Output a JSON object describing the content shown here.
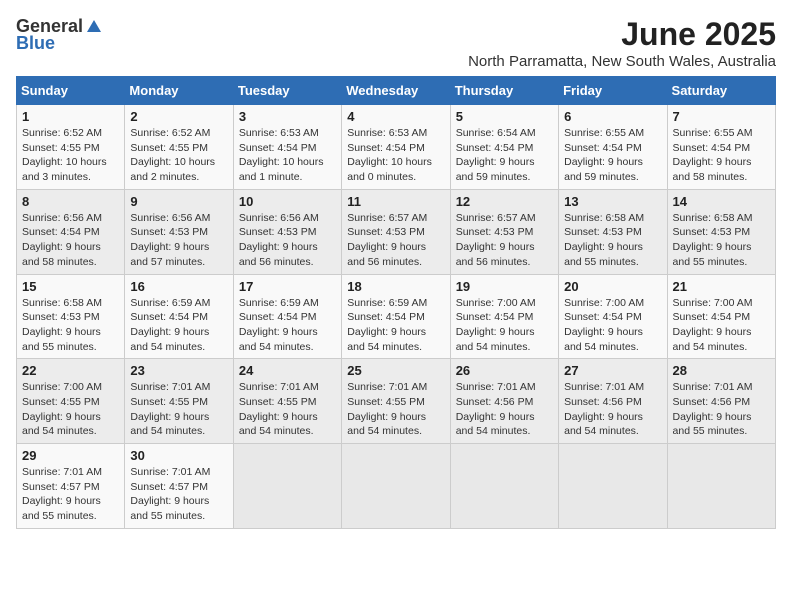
{
  "logo": {
    "general": "General",
    "blue": "Blue"
  },
  "title": "June 2025",
  "location": "North Parramatta, New South Wales, Australia",
  "weekdays": [
    "Sunday",
    "Monday",
    "Tuesday",
    "Wednesday",
    "Thursday",
    "Friday",
    "Saturday"
  ],
  "weeks": [
    [
      {
        "day": "1",
        "rise": "6:52 AM",
        "set": "4:55 PM",
        "daylight": "10 hours and 3 minutes."
      },
      {
        "day": "2",
        "rise": "6:52 AM",
        "set": "4:55 PM",
        "daylight": "10 hours and 2 minutes."
      },
      {
        "day": "3",
        "rise": "6:53 AM",
        "set": "4:54 PM",
        "daylight": "10 hours and 1 minute."
      },
      {
        "day": "4",
        "rise": "6:53 AM",
        "set": "4:54 PM",
        "daylight": "10 hours and 0 minutes."
      },
      {
        "day": "5",
        "rise": "6:54 AM",
        "set": "4:54 PM",
        "daylight": "9 hours and 59 minutes."
      },
      {
        "day": "6",
        "rise": "6:55 AM",
        "set": "4:54 PM",
        "daylight": "9 hours and 59 minutes."
      },
      {
        "day": "7",
        "rise": "6:55 AM",
        "set": "4:54 PM",
        "daylight": "9 hours and 58 minutes."
      }
    ],
    [
      {
        "day": "8",
        "rise": "6:56 AM",
        "set": "4:54 PM",
        "daylight": "9 hours and 58 minutes."
      },
      {
        "day": "9",
        "rise": "6:56 AM",
        "set": "4:53 PM",
        "daylight": "9 hours and 57 minutes."
      },
      {
        "day": "10",
        "rise": "6:56 AM",
        "set": "4:53 PM",
        "daylight": "9 hours and 56 minutes."
      },
      {
        "day": "11",
        "rise": "6:57 AM",
        "set": "4:53 PM",
        "daylight": "9 hours and 56 minutes."
      },
      {
        "day": "12",
        "rise": "6:57 AM",
        "set": "4:53 PM",
        "daylight": "9 hours and 56 minutes."
      },
      {
        "day": "13",
        "rise": "6:58 AM",
        "set": "4:53 PM",
        "daylight": "9 hours and 55 minutes."
      },
      {
        "day": "14",
        "rise": "6:58 AM",
        "set": "4:53 PM",
        "daylight": "9 hours and 55 minutes."
      }
    ],
    [
      {
        "day": "15",
        "rise": "6:58 AM",
        "set": "4:53 PM",
        "daylight": "9 hours and 55 minutes."
      },
      {
        "day": "16",
        "rise": "6:59 AM",
        "set": "4:54 PM",
        "daylight": "9 hours and 54 minutes."
      },
      {
        "day": "17",
        "rise": "6:59 AM",
        "set": "4:54 PM",
        "daylight": "9 hours and 54 minutes."
      },
      {
        "day": "18",
        "rise": "6:59 AM",
        "set": "4:54 PM",
        "daylight": "9 hours and 54 minutes."
      },
      {
        "day": "19",
        "rise": "7:00 AM",
        "set": "4:54 PM",
        "daylight": "9 hours and 54 minutes."
      },
      {
        "day": "20",
        "rise": "7:00 AM",
        "set": "4:54 PM",
        "daylight": "9 hours and 54 minutes."
      },
      {
        "day": "21",
        "rise": "7:00 AM",
        "set": "4:54 PM",
        "daylight": "9 hours and 54 minutes."
      }
    ],
    [
      {
        "day": "22",
        "rise": "7:00 AM",
        "set": "4:55 PM",
        "daylight": "9 hours and 54 minutes."
      },
      {
        "day": "23",
        "rise": "7:01 AM",
        "set": "4:55 PM",
        "daylight": "9 hours and 54 minutes."
      },
      {
        "day": "24",
        "rise": "7:01 AM",
        "set": "4:55 PM",
        "daylight": "9 hours and 54 minutes."
      },
      {
        "day": "25",
        "rise": "7:01 AM",
        "set": "4:55 PM",
        "daylight": "9 hours and 54 minutes."
      },
      {
        "day": "26",
        "rise": "7:01 AM",
        "set": "4:56 PM",
        "daylight": "9 hours and 54 minutes."
      },
      {
        "day": "27",
        "rise": "7:01 AM",
        "set": "4:56 PM",
        "daylight": "9 hours and 54 minutes."
      },
      {
        "day": "28",
        "rise": "7:01 AM",
        "set": "4:56 PM",
        "daylight": "9 hours and 55 minutes."
      }
    ],
    [
      {
        "day": "29",
        "rise": "7:01 AM",
        "set": "4:57 PM",
        "daylight": "9 hours and 55 minutes."
      },
      {
        "day": "30",
        "rise": "7:01 AM",
        "set": "4:57 PM",
        "daylight": "9 hours and 55 minutes."
      },
      null,
      null,
      null,
      null,
      null
    ]
  ]
}
